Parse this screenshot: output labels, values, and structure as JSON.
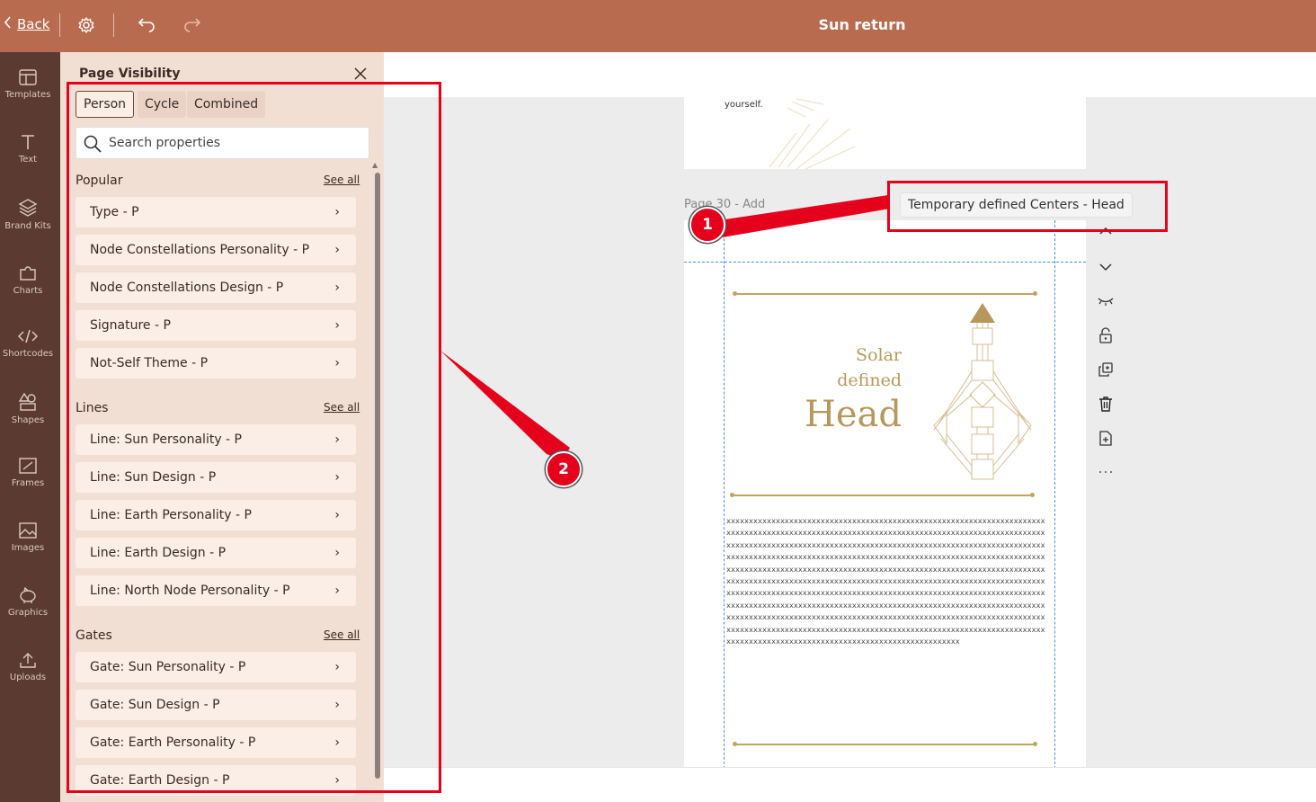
{
  "topbar": {
    "back_label": "Back",
    "title": "Sun return"
  },
  "rail": {
    "items": [
      {
        "label": "Templates",
        "icon": "templates-icon"
      },
      {
        "label": "Text",
        "icon": "text-icon"
      },
      {
        "label": "Brand Kits",
        "icon": "brand-kits-icon"
      },
      {
        "label": "Charts",
        "icon": "charts-icon"
      },
      {
        "label": "Shortcodes",
        "icon": "shortcodes-icon"
      },
      {
        "label": "Shapes",
        "icon": "shapes-icon"
      },
      {
        "label": "Frames",
        "icon": "frames-icon"
      },
      {
        "label": "Images",
        "icon": "images-icon"
      },
      {
        "label": "Graphics",
        "icon": "graphics-icon"
      },
      {
        "label": "Uploads",
        "icon": "uploads-icon"
      }
    ]
  },
  "panel": {
    "title": "Page Visibility",
    "tabs": [
      {
        "label": "Person",
        "active": true
      },
      {
        "label": "Cycle",
        "active": false
      },
      {
        "label": "Combined",
        "active": false
      }
    ],
    "search_placeholder": "Search properties",
    "sections": [
      {
        "title": "Popular",
        "see_all": "See all",
        "items": [
          "Type - P",
          "Node Constellations Personality - P",
          "Node Constellations Design - P",
          "Signature - P",
          "Not-Self Theme - P"
        ]
      },
      {
        "title": "Lines",
        "see_all": "See all",
        "items": [
          "Line: Sun Personality - P",
          "Line: Sun Design - P",
          "Line: Earth Personality - P",
          "Line: Earth Design - P",
          "Line: North Node Personality - P"
        ]
      },
      {
        "title": "Gates",
        "see_all": "See all",
        "items": [
          "Gate: Sun Personality - P",
          "Gate: Sun Design - P",
          "Gate: Earth Personality - P",
          "Gate: Earth Design - P"
        ]
      }
    ]
  },
  "canvas": {
    "prev_page_text": "yourself.",
    "page_label": "Page 30 - Add",
    "tooltip": "Temporary defined Centers - Head",
    "heading_line1": "Solar",
    "heading_line2": "defined",
    "heading_line3": "Head",
    "body_text": "xxxxxxxxxxxxxxxxxxxxxxxxxxxxxxxxxxxxxxxxxxxxxxxxxxxxxxxxxxxxxxxxxxxxxxxxxxxxxxxxxxxxxxxxxxxxxxxxxxxxxxxxxxxxxxxxxxxxxxxxxxxxxxxxxxxxxxxxxxxxxxxxxxxxxxxxxxxxxxxxxxxxxxxxxxxxxxxxxxxxxxxxxxxxxxxxxxxxxxxxxxxxxxxxxxxxxxxxxxxxxxxxxxxxxxxxxxxxxxxxxxxxxxxxxxxxxxxxxxxxxxxxxxxxxxxxxxxxxxxxxxxxxxxxxxxxxxxxxxxxxxxxxxxxxxxxxxxxxxxxxxxxxxxxxxxxxxxxxxxxxxxxxxxxxxxxxxxxxxxxxxxxxxxxxxxxxxxxxxxxxxxxxxxxxxxxxxxxxxxxxxxxxxxxxxxxxxxxxxxxxxxxxxxxxxxxxxxxxxxxxxxxxxxxxxxxxxxxxxxxxxxxxxxxxxxxxxxxxxxxxxxxxxxxxxxxxxxxxxxxxxxxxxxxxxxxxxxxxxxxxxxxxxxxxxxxxxxxxxxxxxxxxxxxxxxxxxxxxxxxxxxxxxxxxxxxxxxxxxxxxxxxxxxxxxxxxxxxxxxxxxxxxxxxxxxxxxxxxxxxxxxxxxxxxxxxxxxxxxxxxxxxxxxxxxxxxxxxxxxxxxxxxxxxxxxxxxxxxxxxxxxxxxxxxxxxxxxxxxxxxxxxxxxxxxxxxxxxxxxxxxxxxxxxxxxxxxxxxxxxxxxxxxxxxxxxxxxxxxxxxx"
  },
  "annotations": {
    "badge1": "1",
    "badge2": "2"
  },
  "colors": {
    "topbar": "#b86b4e",
    "rail": "#5a3a31",
    "panel": "#f2dfd3",
    "callout": "#e5001c",
    "gold": "#c4a55e"
  }
}
